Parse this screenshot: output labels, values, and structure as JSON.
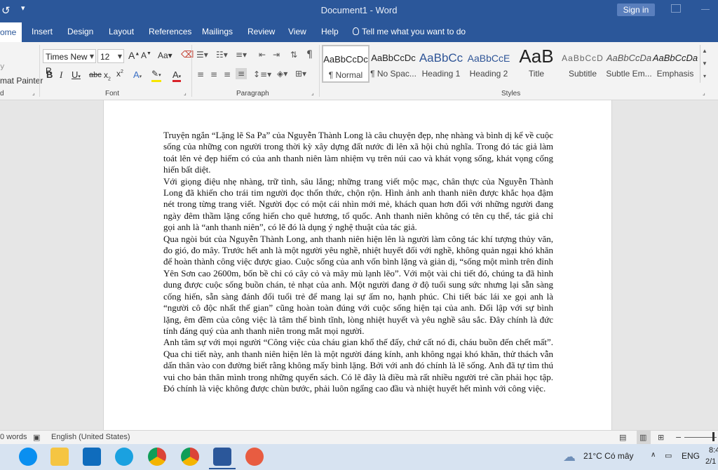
{
  "titlebar": {
    "document_title": "Document1 - Word",
    "signin_label": "Sign in"
  },
  "tabs": [
    {
      "label": "ome",
      "active": true
    },
    {
      "label": "Insert"
    },
    {
      "label": "Design"
    },
    {
      "label": "Layout"
    },
    {
      "label": "References"
    },
    {
      "label": "Mailings"
    },
    {
      "label": "Review"
    },
    {
      "label": "View"
    },
    {
      "label": "Help"
    }
  ],
  "tell_me": "Tell me what you want to do",
  "ribbon": {
    "clipboard": {
      "format_painter": "mat Painter",
      "group_partial": "d"
    },
    "font": {
      "family": "Times New R",
      "size": "12",
      "group_label": "Font"
    },
    "paragraph": {
      "group_label": "Paragraph"
    },
    "styles": {
      "group_label": "Styles",
      "items": [
        {
          "sample": "AaBbCcDc",
          "name": "¶ Normal"
        },
        {
          "sample": "AaBbCcDc",
          "name": "¶ No Spac..."
        },
        {
          "sample": "AaBbCc",
          "name": "Heading 1"
        },
        {
          "sample": "AaBbCcE",
          "name": "Heading 2"
        },
        {
          "sample": "AaB",
          "name": "Title"
        },
        {
          "sample": "AaBbCcD",
          "name": "Subtitle"
        },
        {
          "sample": "AaBbCcDa",
          "name": "Subtle Em..."
        },
        {
          "sample": "AaBbCcDa",
          "name": "Emphasis"
        }
      ]
    }
  },
  "document": {
    "paragraphs": [
      " Truyện ngắn “Lặng lẽ Sa Pa” của Nguyễn Thành Long là câu chuyện đẹp, nhẹ nhàng và bình dị kể về cuộc sống của những con người trong thời kỳ xây dựng đất nước đi lên xã hội chủ nghĩa. Trong đó tác giả làm toát lên vẻ đẹp hiếm có của anh thanh niên làm nhiệm vụ trên núi cao và khát vọng sống, khát vọng cống hiến bất diệt.",
      "Với giọng điệu nhẹ nhàng, trữ tình, sâu lắng; những trang viết mộc mạc, chân thực của Nguyễn Thành Long đã khiến cho trái tim người đọc thổn thức, chộn rộn. Hình ảnh anh thanh niên được khắc họa đậm nét trong từng trang viết. Người đọc có một cái nhìn mới mẻ, khách quan hơn đối với những người đang ngày đêm thầm lặng cống hiến cho quê hương, tổ quốc. Anh thanh niên không có tên cụ thể, tác giả chỉ gọi anh là “anh thanh niên”, có lẽ đó là dụng ý nghệ thuật của tác giả.",
      "Qua ngòi bút của Nguyễn Thành Long, anh thanh niên hiện lên là người làm công tác khí tượng thủy văn, đo gió, đo mây. Trước hết anh là một người yêu nghề, nhiệt huyết đối với nghề, không quản ngại khó khăn để hoàn thành công việc được giao. Cuộc sống của anh vốn bình lặng và giản dị, “sống một mình trên đỉnh Yên Sơn cao 2600m, bốn bề chỉ có cây cỏ và mây mù lạnh lẽo”. Với một vài chi tiết đó, chúng ta đã hình dung được cuộc sống buồn chán, tẻ nhạt của anh. Một người đang ở độ tuổi sung sức nhưng lại sẵn sàng cống hiến, sẵn sàng đánh đổi tuổi trẻ để mang lại sự ấm no, hạnh phúc. Chi tiết bác lái xe gọi anh là “người cô độc nhất thế gian” cũng hoàn toàn đúng với cuộc sống hiện tại của anh. Đối lập với sự bình lặng, êm đềm của công việc là tâm thế bình tĩnh, lòng nhiệt huyết và yêu nghề sâu sắc. Đây chính là đức tính đáng quý của anh thanh niên trong mắt mọi người.",
      "Anh tâm sự với mọi người “Công việc của cháu gian khổ thế đấy, chứ cất nó đi, cháu buồn đến chết mất”. Qua chi tiết này, anh thanh niên hiện lên là một người đáng kính, anh không ngại khó khăn, thử thách vẫn dấn thân vào con đường biết rằng không mấy bình lặng. Bởi với anh đó chính là lẽ sống. Anh đã tự tìm thú vui cho bản thân mình trong những quyển sách. Có lẽ đây là điều mà rất nhiều người trẻ cần phải học tập. Đó chính là việc không được chùn bước, phải luôn ngẩng cao đầu và nhiệt huyết hết mình với công việc."
    ]
  },
  "statusbar": {
    "words": "0 words",
    "language": "English (United States)"
  },
  "taskbar": {
    "weather": "21°C Có mây",
    "lang": "ENG",
    "time": "8:4",
    "date": "2/1"
  }
}
